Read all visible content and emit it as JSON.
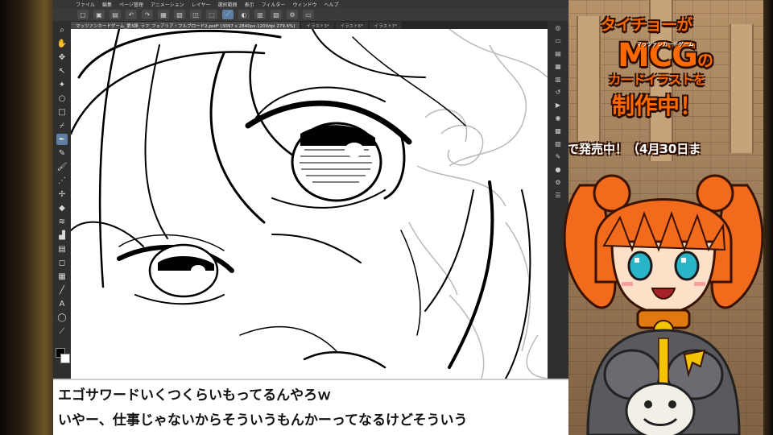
{
  "app": {
    "menu": [
      "ファイル",
      "編集",
      "ページ管理",
      "アニメーション",
      "レイヤー",
      "選択範囲",
      "表示",
      "フィルター",
      "ウィンドウ",
      "ヘルプ"
    ],
    "tabs": [
      {
        "label": "マッツァンカードゲーム_第3弾_ラフ_フェアリア・フルブロード2.psd* (3097 x 2840px 1200dpi 279.6%)",
        "active": true
      },
      {
        "label": "イラスト3*",
        "active": false
      },
      {
        "label": "イラスト6*",
        "active": false
      },
      {
        "label": "イラスト7*",
        "active": false
      }
    ],
    "toolbar_icons": [
      "new-icon",
      "open-icon",
      "save-icon",
      "undo-icon",
      "redo-icon",
      "grid-icon",
      "ruler-icon",
      "snap-icon",
      "transform-icon",
      "brush-icon",
      "color-icon",
      "palette-icon",
      "layer-icon",
      "settings-icon",
      "window-icon"
    ],
    "tools": [
      {
        "name": "zoom-tool",
        "glyph": "⌕"
      },
      {
        "name": "hand-tool",
        "glyph": "✋"
      },
      {
        "name": "move-tool",
        "glyph": "✥"
      },
      {
        "name": "operation-tool",
        "glyph": "↖"
      },
      {
        "name": "magic-wand-tool",
        "glyph": "✦"
      },
      {
        "name": "lasso-tool",
        "glyph": "○"
      },
      {
        "name": "select-tool",
        "glyph": "□"
      },
      {
        "name": "eyedropper-tool",
        "glyph": "⌿"
      },
      {
        "name": "pen-tool",
        "glyph": "✒",
        "active": true
      },
      {
        "name": "pencil-tool",
        "glyph": "✎"
      },
      {
        "name": "brush-tool",
        "glyph": "🖌"
      },
      {
        "name": "airbrush-tool",
        "glyph": "⋰"
      },
      {
        "name": "decoration-tool",
        "glyph": "✢"
      },
      {
        "name": "eraser-tool",
        "glyph": "◆"
      },
      {
        "name": "blend-tool",
        "glyph": "≋"
      },
      {
        "name": "fill-tool",
        "glyph": "▟"
      },
      {
        "name": "gradient-tool",
        "glyph": "▤"
      },
      {
        "name": "figure-tool",
        "glyph": "◻"
      },
      {
        "name": "frame-tool",
        "glyph": "▦"
      },
      {
        "name": "ruler-tool",
        "glyph": "╱"
      },
      {
        "name": "text-tool",
        "glyph": "A"
      },
      {
        "name": "balloon-tool",
        "glyph": "◯"
      },
      {
        "name": "correct-line-tool",
        "glyph": "⟋"
      }
    ],
    "right_icons": [
      "navigator-icon",
      "sub-view-icon",
      "layer-property-icon",
      "layer-icon",
      "material-icon",
      "history-icon",
      "auto-action-icon",
      "color-wheel-icon",
      "color-set-icon",
      "intermediate-color-icon",
      "tool-property-icon",
      "brush-size-icon",
      "settings-icon",
      "menu-icon"
    ]
  },
  "game": {
    "headline_1": "タイチョーが",
    "headline_2": "MCG",
    "headline_2_suffix": "の",
    "headline_2_small": "マッツァンカードゲーム",
    "headline_3": "カードイラストを",
    "headline_4": "制作中！",
    "ticker": "で発売中！（4月30日ま"
  },
  "subtitles": {
    "line1": "エゴサワードいくつくらいもってるんやろｗ",
    "line2": "いやー、仕事じゃないからそういうもんかーってなるけどそういう"
  },
  "colors": {
    "accent": "#ff6a00",
    "outline": "#2a0d00",
    "hair": "#f26a1b",
    "ui_dark": "#2b2b2b"
  }
}
